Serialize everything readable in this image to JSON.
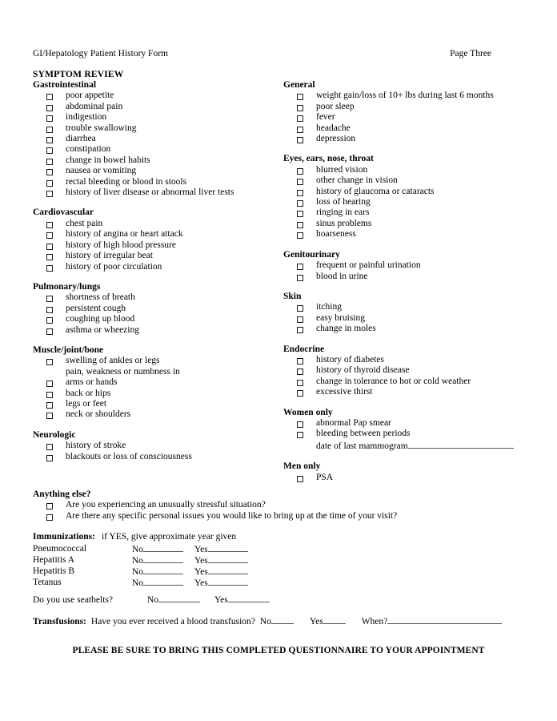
{
  "header": {
    "form_title": "GI/Hepatology Patient History Form",
    "page_label": "Page Three"
  },
  "main_title": "SYMPTOM REVIEW",
  "left_column": [
    {
      "heading": "Gastrointestinal",
      "items": [
        {
          "label": "poor appetite",
          "checkbox": true
        },
        {
          "label": "abdominal pain",
          "checkbox": true
        },
        {
          "label": "indigestion",
          "checkbox": true
        },
        {
          "label": "trouble swallowing",
          "checkbox": true
        },
        {
          "label": "diarrhea",
          "checkbox": true
        },
        {
          "label": "constipation",
          "checkbox": true
        },
        {
          "label": "change in bowel habits",
          "checkbox": true
        },
        {
          "label": "nausea or vomiting",
          "checkbox": true
        },
        {
          "label": "rectal bleeding or blood in stools",
          "checkbox": true
        },
        {
          "label": "history of liver disease or abnormal liver tests",
          "checkbox": true
        }
      ]
    },
    {
      "heading": "Cardiovascular",
      "items": [
        {
          "label": "chest pain",
          "checkbox": true
        },
        {
          "label": "history of angina or heart attack",
          "checkbox": true
        },
        {
          "label": "history of high blood pressure",
          "checkbox": true
        },
        {
          "label": "history of irregular beat",
          "checkbox": true
        },
        {
          "label": "history of poor circulation",
          "checkbox": true
        }
      ]
    },
    {
      "heading": "Pulmonary/lungs",
      "items": [
        {
          "label": "shortness of breath",
          "checkbox": true
        },
        {
          "label": "persistent cough",
          "checkbox": true
        },
        {
          "label": "coughing up blood",
          "checkbox": true
        },
        {
          "label": "asthma or wheezing",
          "checkbox": true
        }
      ]
    },
    {
      "heading": "Muscle/joint/bone",
      "items": [
        {
          "label": "swelling of ankles or legs",
          "checkbox": true
        },
        {
          "label": "pain, weakness or numbness in",
          "checkbox": false
        },
        {
          "label": "arms or hands",
          "checkbox": true
        },
        {
          "label": "back or hips",
          "checkbox": true
        },
        {
          "label": "legs or feet",
          "checkbox": true
        },
        {
          "label": "neck or shoulders",
          "checkbox": true
        }
      ]
    },
    {
      "heading": "Neurologic",
      "items": [
        {
          "label": "history of stroke",
          "checkbox": true
        },
        {
          "label": "blackouts or loss of consciousness",
          "checkbox": true
        }
      ]
    }
  ],
  "right_column": [
    {
      "heading": "General",
      "items": [
        {
          "label": "weight gain/loss of  10+ lbs during last 6 months",
          "checkbox": true
        },
        {
          "label": "poor sleep",
          "checkbox": true
        },
        {
          "label": "fever",
          "checkbox": true
        },
        {
          "label": "headache",
          "checkbox": true
        },
        {
          "label": "depression",
          "checkbox": true
        }
      ]
    },
    {
      "heading": "Eyes, ears, nose, throat",
      "items": [
        {
          "label": "blurred vision",
          "checkbox": true
        },
        {
          "label": "other change in vision",
          "checkbox": true
        },
        {
          "label": "history of glaucoma or cataracts",
          "checkbox": true
        },
        {
          "label": "loss of hearing",
          "checkbox": true
        },
        {
          "label": "ringing in ears",
          "checkbox": true
        },
        {
          "label": "sinus problems",
          "checkbox": true
        },
        {
          "label": "hoarseness",
          "checkbox": true
        }
      ]
    },
    {
      "heading": "Genitourinary",
      "items": [
        {
          "label": "frequent or painful urination",
          "checkbox": true
        },
        {
          "label": "blood in urine",
          "checkbox": true
        }
      ]
    },
    {
      "heading": "Skin",
      "items": [
        {
          "label": "itching",
          "checkbox": true
        },
        {
          "label": "easy bruising",
          "checkbox": true
        },
        {
          "label": "change in moles",
          "checkbox": true
        }
      ]
    },
    {
      "heading": "Endocrine",
      "items": [
        {
          "label": "history of diabetes",
          "checkbox": true
        },
        {
          "label": "history of thyroid disease",
          "checkbox": true
        },
        {
          "label": "change in tolerance to hot or cold weather",
          "checkbox": true
        },
        {
          "label": "excessive thirst",
          "checkbox": true
        }
      ]
    },
    {
      "heading": "Women only",
      "items": [
        {
          "label": "abnormal Pap smear",
          "checkbox": true
        },
        {
          "label": "bleeding between periods",
          "checkbox": true
        },
        {
          "label": "date of last mammogram",
          "checkbox": false,
          "rule": true
        }
      ]
    },
    {
      "heading": "Men only",
      "items": [
        {
          "label": "PSA",
          "checkbox": true
        }
      ]
    }
  ],
  "anything_else": {
    "heading": "Anything else?",
    "items": [
      {
        "label": "Are you experiencing an unusually stressful situation?",
        "checkbox": true
      },
      {
        "label": "Are there any specific personal issues you would like to bring up at the time of your visit?",
        "checkbox": true
      }
    ]
  },
  "immunizations": {
    "title": "Immunizations:",
    "subtitle": "if YES, give approximate year given",
    "no_label": "No",
    "yes_label": "Yes",
    "rows": [
      {
        "name": "Pneumococcal"
      },
      {
        "name": "Hepatitis A"
      },
      {
        "name": "Hepatitis B"
      },
      {
        "name": "Tetanus"
      }
    ]
  },
  "seatbelts": {
    "question": "Do you use seatbelts?",
    "no_label": "No",
    "yes_label": "Yes"
  },
  "transfusions": {
    "title": "Transfusions:",
    "question": "Have you ever received a blood transfusion?",
    "no_label": "No",
    "yes_label": "Yes",
    "when_label": "When?"
  },
  "footer_note": "PLEASE BE SURE TO BRING THIS COMPLETED QUESTIONNAIRE TO YOUR APPOINTMENT"
}
